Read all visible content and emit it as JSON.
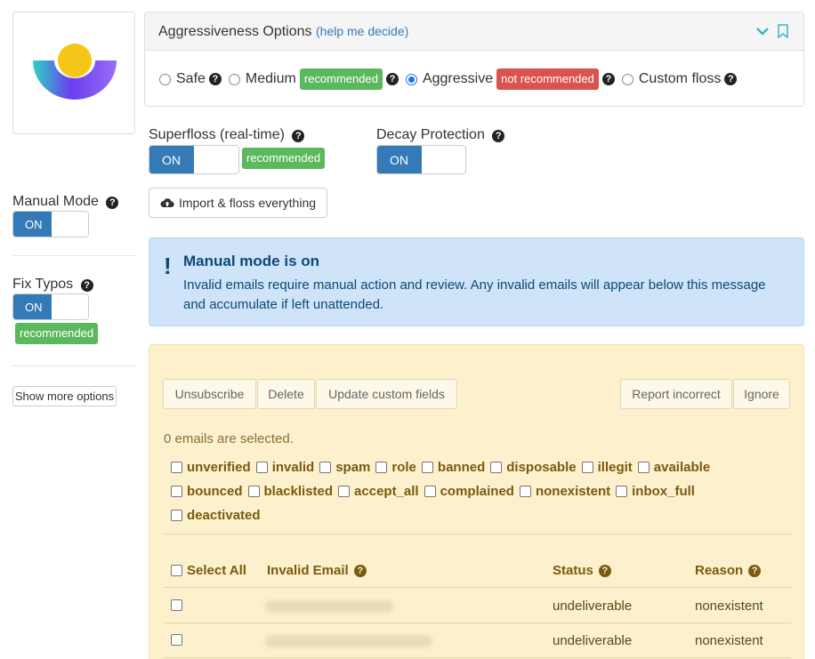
{
  "aggressiveness": {
    "title": "Aggressiveness Options",
    "help_link": "help me decide",
    "paren_open": "(",
    "paren_close": ")",
    "options": [
      {
        "label": "Safe",
        "selected": false
      },
      {
        "label": "Medium",
        "badge": "recommended",
        "selected": false
      },
      {
        "label": "Aggressive",
        "badge": "not recommended",
        "selected": true
      },
      {
        "label": "Custom floss",
        "selected": false
      }
    ]
  },
  "superfloss": {
    "label": "Superfloss (real-time)",
    "toggle": "ON",
    "badge": "recommended"
  },
  "decay": {
    "label": "Decay Protection",
    "toggle": "ON"
  },
  "manual_mode": {
    "label": "Manual Mode",
    "toggle": "ON"
  },
  "fix_typos": {
    "label": "Fix Typos",
    "toggle": "ON",
    "badge": "recommended"
  },
  "import_button": "Import & floss everything",
  "show_more": "Show more options",
  "alert": {
    "title": "Manual mode is on",
    "message": "Invalid emails require manual action and review. Any invalid emails will appear below this message and accumulate if left unattended."
  },
  "actions": {
    "unsubscribe": "Unsubscribe",
    "delete": "Delete",
    "update_fields": "Update custom fields",
    "report_incorrect": "Report incorrect",
    "ignore": "Ignore"
  },
  "selected_text": "0 emails are selected.",
  "filters": {
    "row1": [
      "unverified",
      "invalid",
      "spam",
      "role",
      "banned",
      "disposable",
      "illegit",
      "available"
    ],
    "row2": [
      "bounced",
      "blacklisted",
      "accept_all",
      "complained",
      "nonexistent",
      "inbox_full"
    ],
    "row3": [
      "deactivated"
    ]
  },
  "table": {
    "select_all": "Select All",
    "col_email": "Invalid Email",
    "col_status": "Status",
    "col_reason": "Reason",
    "rows": [
      {
        "status": "undeliverable",
        "reason": "nonexistent"
      },
      {
        "status": "undeliverable",
        "reason": "nonexistent"
      }
    ]
  },
  "colors": {
    "primary": "#337ab7",
    "success": "#5cb85c",
    "danger": "#d9534f",
    "alert_bg": "#cfe4f9",
    "panel_bg": "#fcf1cc"
  }
}
